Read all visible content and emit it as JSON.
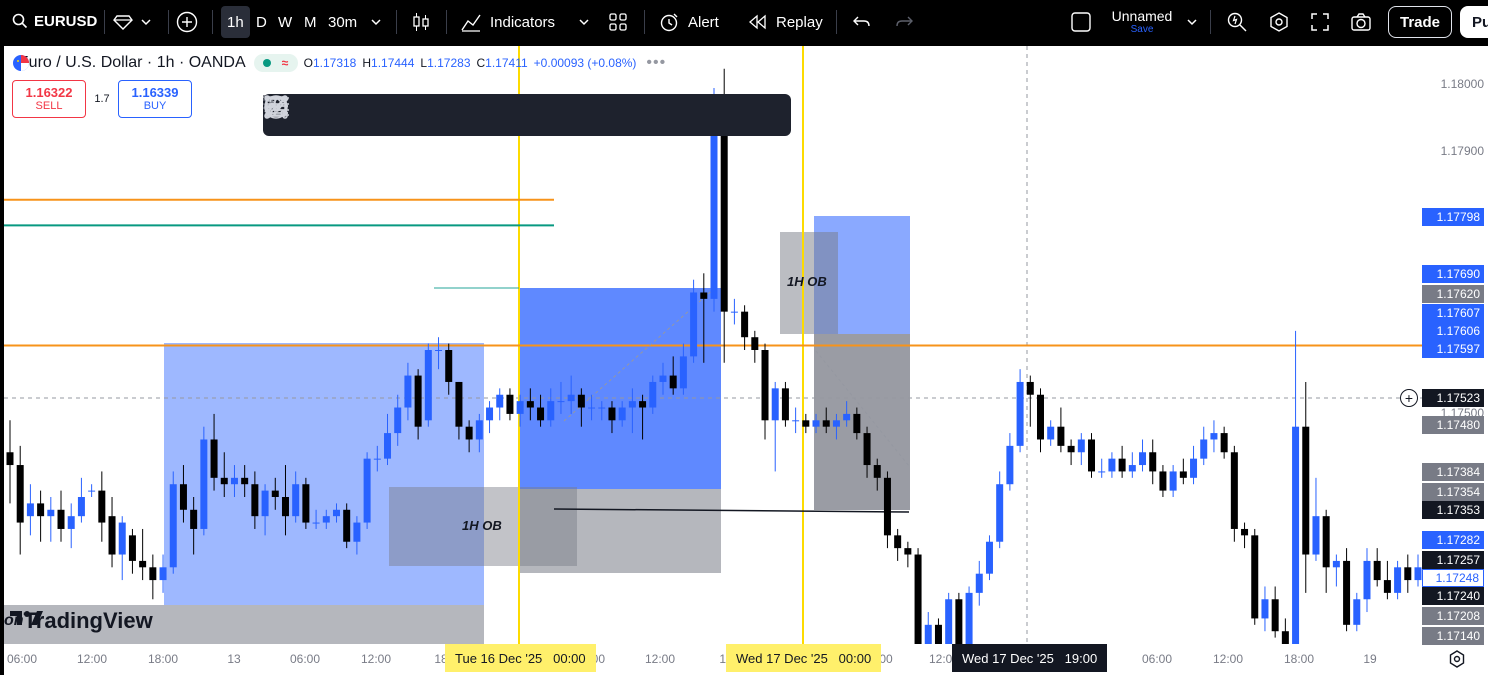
{
  "toolbar": {
    "symbol": "EURUSD",
    "timeframes": [
      "1h",
      "D",
      "W",
      "M",
      "30m"
    ],
    "active_timeframe": "1h",
    "indicators_label": "Indicators",
    "alert_label": "Alert",
    "replay_label": "Replay",
    "layout_name": "Unnamed",
    "layout_save": "Save",
    "trade_label": "Trade",
    "publish_label": "Pu"
  },
  "legend": {
    "title": "Euro / U.S. Dollar · 1h · OANDA",
    "open_key": "O",
    "open": "1.17318",
    "high_key": "H",
    "high": "1.17444",
    "low_key": "L",
    "low": "1.17283",
    "close_key": "C",
    "close": "1.17411",
    "change": "+0.00093 (+0.08%)"
  },
  "order": {
    "sell_price": "1.16322",
    "sell_label": "SELL",
    "spread": "1.7",
    "buy_price": "1.16339",
    "buy_label": "BUY"
  },
  "drawing_tools": [
    "horizontal-lines-icon",
    "circle-target-icon",
    "fib-lines-icon",
    "text-icon",
    "trend-line-icon",
    "path-icon",
    "brush-icon",
    "highlighter-icon",
    "line-icon",
    "rectangle-icon",
    "pitchfork-icon",
    "comment-icon"
  ],
  "annotations": {
    "ob_label_left": "1H OB",
    "ob_label_right": "1H OB",
    "watermark": "TradingView",
    "watermark_partial": "on"
  },
  "price_axis": {
    "ticks": [
      "1.18000",
      "1.17900",
      "1.17500"
    ],
    "labels": [
      {
        "text": "1.17798",
        "color": "#2962ff"
      },
      {
        "text": "1.17690",
        "color": "#2962ff"
      },
      {
        "text": "1.17620",
        "color": "#787b86"
      },
      {
        "text": "1.17607",
        "color": "#2962ff"
      },
      {
        "text": "1.17606",
        "color": "#2962ff"
      },
      {
        "text": "1.17597",
        "color": "#2962ff"
      },
      {
        "text": "1.17523",
        "color": "#131722"
      },
      {
        "text": "1.17480",
        "color": "#787b86"
      },
      {
        "text": "1.17384",
        "color": "#787b86"
      },
      {
        "text": "1.17354",
        "color": "#787b86"
      },
      {
        "text": "1.17353",
        "color": "#131722"
      },
      {
        "text": "1.17282",
        "color": "#2962ff"
      },
      {
        "text": "1.17257",
        "color": "#131722"
      },
      {
        "text": "1.17248",
        "color": "#ffffff"
      },
      {
        "text": "1.17240",
        "color": "#131722"
      },
      {
        "text": "1.17208",
        "color": "#787b86"
      },
      {
        "text": "1.17140",
        "color": "#787b86"
      }
    ]
  },
  "time_axis": {
    "ticks": [
      "06:00",
      "12:00",
      "18:00",
      "13",
      "06:00",
      "12:00",
      "18",
      "06:00",
      "12:00",
      "18",
      "00",
      "12:00",
      "06:00",
      "12:00",
      "18:00",
      "19"
    ],
    "marker_1": "Tue 16 Dec '25   00:00",
    "marker_2": "Wed 17 Dec '25   00:00",
    "crosshair": "Wed 17 Dec '25   19:00"
  },
  "chart_data": {
    "type": "candlestick",
    "symbol": "EURUSD",
    "interval": "1h",
    "ylim": [
      1.1714,
      1.1806
    ],
    "series": [
      {
        "o": 1.1744,
        "c": 1.1742,
        "h": 1.1749,
        "l": 1.1736
      },
      {
        "o": 1.1742,
        "c": 1.1733,
        "h": 1.1745,
        "l": 1.1728
      },
      {
        "o": 1.1734,
        "c": 1.1736,
        "h": 1.1739,
        "l": 1.1731
      },
      {
        "o": 1.1736,
        "c": 1.1734,
        "h": 1.1738,
        "l": 1.173
      },
      {
        "o": 1.1734,
        "c": 1.1735,
        "h": 1.1737,
        "l": 1.173
      },
      {
        "o": 1.1735,
        "c": 1.1732,
        "h": 1.1738,
        "l": 1.173
      },
      {
        "o": 1.1732,
        "c": 1.1734,
        "h": 1.1736,
        "l": 1.1729
      },
      {
        "o": 1.1734,
        "c": 1.1737,
        "h": 1.174,
        "l": 1.1733
      },
      {
        "o": 1.1738,
        "c": 1.1738,
        "h": 1.1739,
        "l": 1.1737
      },
      {
        "o": 1.1738,
        "c": 1.1733,
        "h": 1.1741,
        "l": 1.173
      },
      {
        "o": 1.1734,
        "c": 1.1728,
        "h": 1.1737,
        "l": 1.1726
      },
      {
        "o": 1.1728,
        "c": 1.1733,
        "h": 1.1734,
        "l": 1.1724
      },
      {
        "o": 1.1731,
        "c": 1.1727,
        "h": 1.1732,
        "l": 1.1725
      },
      {
        "o": 1.1727,
        "c": 1.1726,
        "h": 1.1732,
        "l": 1.1724
      },
      {
        "o": 1.1726,
        "c": 1.1724,
        "h": 1.1728,
        "l": 1.1721
      },
      {
        "o": 1.1724,
        "c": 1.1726,
        "h": 1.1728,
        "l": 1.1722
      },
      {
        "o": 1.1726,
        "c": 1.1739,
        "h": 1.1741,
        "l": 1.1725
      },
      {
        "o": 1.1739,
        "c": 1.1735,
        "h": 1.1742,
        "l": 1.1733
      },
      {
        "o": 1.1735,
        "c": 1.1732,
        "h": 1.1737,
        "l": 1.1728
      },
      {
        "o": 1.1732,
        "c": 1.1746,
        "h": 1.1748,
        "l": 1.1731
      },
      {
        "o": 1.1746,
        "c": 1.174,
        "h": 1.175,
        "l": 1.1738
      },
      {
        "o": 1.174,
        "c": 1.1739,
        "h": 1.1744,
        "l": 1.1737
      },
      {
        "o": 1.1739,
        "c": 1.174,
        "h": 1.1742,
        "l": 1.1737
      },
      {
        "o": 1.174,
        "c": 1.1739,
        "h": 1.1742,
        "l": 1.1737
      },
      {
        "o": 1.1739,
        "c": 1.1734,
        "h": 1.1741,
        "l": 1.1732
      },
      {
        "o": 1.1734,
        "c": 1.1738,
        "h": 1.1739,
        "l": 1.1731
      },
      {
        "o": 1.1738,
        "c": 1.1737,
        "h": 1.174,
        "l": 1.1735
      },
      {
        "o": 1.1737,
        "c": 1.1734,
        "h": 1.1742,
        "l": 1.1731
      },
      {
        "o": 1.1734,
        "c": 1.1739,
        "h": 1.1741,
        "l": 1.1733
      },
      {
        "o": 1.1739,
        "c": 1.1733,
        "h": 1.174,
        "l": 1.1732
      },
      {
        "o": 1.1733,
        "c": 1.1733,
        "h": 1.1735,
        "l": 1.1732
      },
      {
        "o": 1.1733,
        "c": 1.1734,
        "h": 1.1735,
        "l": 1.1732
      },
      {
        "o": 1.1734,
        "c": 1.1735,
        "h": 1.1736,
        "l": 1.1733
      },
      {
        "o": 1.1735,
        "c": 1.173,
        "h": 1.1736,
        "l": 1.1729
      },
      {
        "o": 1.173,
        "c": 1.1733,
        "h": 1.1734,
        "l": 1.1728
      },
      {
        "o": 1.1733,
        "c": 1.1743,
        "h": 1.1744,
        "l": 1.1732
      },
      {
        "o": 1.1743,
        "c": 1.1743,
        "h": 1.1745,
        "l": 1.1741
      },
      {
        "o": 1.1743,
        "c": 1.1747,
        "h": 1.175,
        "l": 1.1742
      },
      {
        "o": 1.1747,
        "c": 1.1751,
        "h": 1.1753,
        "l": 1.1745
      },
      {
        "o": 1.1751,
        "c": 1.1756,
        "h": 1.1758,
        "l": 1.1749
      },
      {
        "o": 1.1756,
        "c": 1.1748,
        "h": 1.1757,
        "l": 1.1746
      },
      {
        "o": 1.1749,
        "c": 1.176,
        "h": 1.1761,
        "l": 1.1748
      },
      {
        "o": 1.176,
        "c": 1.176,
        "h": 1.1762,
        "l": 1.1757
      },
      {
        "o": 1.176,
        "c": 1.1755,
        "h": 1.1761,
        "l": 1.1753
      },
      {
        "o": 1.1755,
        "c": 1.1748,
        "h": 1.1755,
        "l": 1.1746
      },
      {
        "o": 1.1748,
        "c": 1.1746,
        "h": 1.1749,
        "l": 1.1744
      },
      {
        "o": 1.1746,
        "c": 1.1749,
        "h": 1.175,
        "l": 1.1744
      },
      {
        "o": 1.1749,
        "c": 1.1751,
        "h": 1.1752,
        "l": 1.1747
      },
      {
        "o": 1.1751,
        "c": 1.1753,
        "h": 1.1754,
        "l": 1.1749
      },
      {
        "o": 1.1753,
        "c": 1.175,
        "h": 1.1754,
        "l": 1.1749
      },
      {
        "o": 1.175,
        "c": 1.1752,
        "h": 1.1753,
        "l": 1.1748
      },
      {
        "o": 1.1752,
        "c": 1.1751,
        "h": 1.1754,
        "l": 1.1749
      },
      {
        "o": 1.1751,
        "c": 1.1749,
        "h": 1.1753,
        "l": 1.1748
      },
      {
        "o": 1.1749,
        "c": 1.1752,
        "h": 1.1754,
        "l": 1.1748
      },
      {
        "o": 1.1752,
        "c": 1.1752,
        "h": 1.1755,
        "l": 1.175
      },
      {
        "o": 1.1752,
        "c": 1.1753,
        "h": 1.1756,
        "l": 1.175
      },
      {
        "o": 1.1753,
        "c": 1.1751,
        "h": 1.1754,
        "l": 1.1748
      },
      {
        "o": 1.1751,
        "c": 1.1751,
        "h": 1.1753,
        "l": 1.1749
      },
      {
        "o": 1.1751,
        "c": 1.1751,
        "h": 1.1752,
        "l": 1.1749
      },
      {
        "o": 1.1751,
        "c": 1.1749,
        "h": 1.1752,
        "l": 1.1747
      },
      {
        "o": 1.1749,
        "c": 1.1751,
        "h": 1.1752,
        "l": 1.1748
      },
      {
        "o": 1.1751,
        "c": 1.1752,
        "h": 1.1754,
        "l": 1.1747
      },
      {
        "o": 1.1752,
        "c": 1.1751,
        "h": 1.1753,
        "l": 1.1746
      },
      {
        "o": 1.1751,
        "c": 1.1755,
        "h": 1.1756,
        "l": 1.175
      },
      {
        "o": 1.1755,
        "c": 1.1756,
        "h": 1.1758,
        "l": 1.1753
      },
      {
        "o": 1.1756,
        "c": 1.1754,
        "h": 1.1759,
        "l": 1.1753
      },
      {
        "o": 1.1754,
        "c": 1.1759,
        "h": 1.1761,
        "l": 1.1753
      },
      {
        "o": 1.1759,
        "c": 1.1769,
        "h": 1.1771,
        "l": 1.1758
      },
      {
        "o": 1.1769,
        "c": 1.1768,
        "h": 1.1772,
        "l": 1.1758
      },
      {
        "o": 1.1768,
        "c": 1.18,
        "h": 1.1801,
        "l": 1.1766
      },
      {
        "o": 1.18,
        "c": 1.1766,
        "h": 1.1804,
        "l": 1.1758
      },
      {
        "o": 1.1766,
        "c": 1.1766,
        "h": 1.1768,
        "l": 1.1764
      },
      {
        "o": 1.1766,
        "c": 1.1762,
        "h": 1.1767,
        "l": 1.176
      },
      {
        "o": 1.1762,
        "c": 1.176,
        "h": 1.1763,
        "l": 1.1758
      },
      {
        "o": 1.176,
        "c": 1.1749,
        "h": 1.1761,
        "l": 1.1746
      },
      {
        "o": 1.1749,
        "c": 1.1754,
        "h": 1.1755,
        "l": 1.1741
      },
      {
        "o": 1.1754,
        "c": 1.1749,
        "h": 1.1755,
        "l": 1.1748
      },
      {
        "o": 1.1749,
        "c": 1.1749,
        "h": 1.1751,
        "l": 1.1747
      },
      {
        "o": 1.1749,
        "c": 1.1748,
        "h": 1.175,
        "l": 1.1747
      },
      {
        "o": 1.1748,
        "c": 1.1749,
        "h": 1.175,
        "l": 1.1747
      },
      {
        "o": 1.1749,
        "c": 1.1748,
        "h": 1.1751,
        "l": 1.1747
      },
      {
        "o": 1.1748,
        "c": 1.1749,
        "h": 1.175,
        "l": 1.1746
      },
      {
        "o": 1.1749,
        "c": 1.175,
        "h": 1.1752,
        "l": 1.1748
      },
      {
        "o": 1.175,
        "c": 1.1747,
        "h": 1.1751,
        "l": 1.1746
      },
      {
        "o": 1.1747,
        "c": 1.1742,
        "h": 1.1748,
        "l": 1.174
      },
      {
        "o": 1.1742,
        "c": 1.174,
        "h": 1.1743,
        "l": 1.1738
      },
      {
        "o": 1.174,
        "c": 1.1731,
        "h": 1.1741,
        "l": 1.1729
      },
      {
        "o": 1.1731,
        "c": 1.1729,
        "h": 1.1732,
        "l": 1.1727
      },
      {
        "o": 1.1729,
        "c": 1.1728,
        "h": 1.173,
        "l": 1.1726
      },
      {
        "o": 1.1728,
        "c": 1.1714,
        "h": 1.1729,
        "l": 1.1714
      },
      {
        "o": 1.1714,
        "c": 1.1717,
        "h": 1.1719,
        "l": 1.1714
      },
      {
        "o": 1.1717,
        "c": 1.1714,
        "h": 1.1718,
        "l": 1.1714
      },
      {
        "o": 1.1714,
        "c": 1.1721,
        "h": 1.1722,
        "l": 1.1714
      },
      {
        "o": 1.1721,
        "c": 1.1714,
        "h": 1.1722,
        "l": 1.1714
      },
      {
        "o": 1.1714,
        "c": 1.1722,
        "h": 1.1723,
        "l": 1.1714
      },
      {
        "o": 1.1722,
        "c": 1.1725,
        "h": 1.1727,
        "l": 1.172
      },
      {
        "o": 1.1725,
        "c": 1.173,
        "h": 1.1731,
        "l": 1.1724
      },
      {
        "o": 1.173,
        "c": 1.1739,
        "h": 1.1741,
        "l": 1.1729
      },
      {
        "o": 1.1739,
        "c": 1.1745,
        "h": 1.1747,
        "l": 1.1738
      },
      {
        "o": 1.1745,
        "c": 1.1755,
        "h": 1.1757,
        "l": 1.1744
      },
      {
        "o": 1.1755,
        "c": 1.1753,
        "h": 1.1756,
        "l": 1.1748
      },
      {
        "o": 1.1753,
        "c": 1.1746,
        "h": 1.1754,
        "l": 1.1744
      },
      {
        "o": 1.1746,
        "c": 1.1748,
        "h": 1.1749,
        "l": 1.1745
      },
      {
        "o": 1.1748,
        "c": 1.1745,
        "h": 1.1751,
        "l": 1.1744
      },
      {
        "o": 1.1745,
        "c": 1.1744,
        "h": 1.1746,
        "l": 1.1742
      },
      {
        "o": 1.1744,
        "c": 1.1746,
        "h": 1.1747,
        "l": 1.1742
      },
      {
        "o": 1.1746,
        "c": 1.1741,
        "h": 1.1747,
        "l": 1.174
      },
      {
        "o": 1.1741,
        "c": 1.1741,
        "h": 1.1743,
        "l": 1.174
      },
      {
        "o": 1.1741,
        "c": 1.1743,
        "h": 1.1744,
        "l": 1.174
      },
      {
        "o": 1.1743,
        "c": 1.1741,
        "h": 1.1745,
        "l": 1.174
      },
      {
        "o": 1.1741,
        "c": 1.1742,
        "h": 1.1744,
        "l": 1.174
      },
      {
        "o": 1.1742,
        "c": 1.1744,
        "h": 1.1746,
        "l": 1.1741
      },
      {
        "o": 1.1744,
        "c": 1.1741,
        "h": 1.1746,
        "l": 1.1739
      },
      {
        "o": 1.1741,
        "c": 1.1738,
        "h": 1.1742,
        "l": 1.1737
      },
      {
        "o": 1.1738,
        "c": 1.1741,
        "h": 1.1742,
        "l": 1.1737
      },
      {
        "o": 1.1741,
        "c": 1.174,
        "h": 1.1743,
        "l": 1.1739
      },
      {
        "o": 1.174,
        "c": 1.1743,
        "h": 1.1745,
        "l": 1.1739
      },
      {
        "o": 1.1743,
        "c": 1.1746,
        "h": 1.1748,
        "l": 1.1742
      },
      {
        "o": 1.1746,
        "c": 1.1747,
        "h": 1.1749,
        "l": 1.1744
      },
      {
        "o": 1.1747,
        "c": 1.1744,
        "h": 1.1748,
        "l": 1.1743
      },
      {
        "o": 1.1744,
        "c": 1.1732,
        "h": 1.1745,
        "l": 1.173
      },
      {
        "o": 1.1732,
        "c": 1.1731,
        "h": 1.1733,
        "l": 1.1729
      },
      {
        "o": 1.1731,
        "c": 1.1718,
        "h": 1.1732,
        "l": 1.1717
      },
      {
        "o": 1.1718,
        "c": 1.1721,
        "h": 1.1723,
        "l": 1.1716
      },
      {
        "o": 1.1721,
        "c": 1.1716,
        "h": 1.1723,
        "l": 1.1715
      },
      {
        "o": 1.1716,
        "c": 1.1714,
        "h": 1.1718,
        "l": 1.1714
      },
      {
        "o": 1.1714,
        "c": 1.1748,
        "h": 1.1763,
        "l": 1.1714
      },
      {
        "o": 1.1748,
        "c": 1.1728,
        "h": 1.1755,
        "l": 1.1722
      },
      {
        "o": 1.1728,
        "c": 1.1734,
        "h": 1.174,
        "l": 1.1727
      },
      {
        "o": 1.1734,
        "c": 1.1726,
        "h": 1.1735,
        "l": 1.1722
      },
      {
        "o": 1.1726,
        "c": 1.1727,
        "h": 1.1728,
        "l": 1.1723
      },
      {
        "o": 1.1727,
        "c": 1.1717,
        "h": 1.1729,
        "l": 1.1716
      },
      {
        "o": 1.1717,
        "c": 1.1721,
        "h": 1.1722,
        "l": 1.1716
      },
      {
        "o": 1.1721,
        "c": 1.1727,
        "h": 1.1729,
        "l": 1.1719
      },
      {
        "o": 1.1727,
        "c": 1.1724,
        "h": 1.1729,
        "l": 1.1723
      },
      {
        "o": 1.1724,
        "c": 1.1722,
        "h": 1.1727,
        "l": 1.1721
      },
      {
        "o": 1.1722,
        "c": 1.1726,
        "h": 1.1727,
        "l": 1.1721
      },
      {
        "o": 1.1726,
        "c": 1.1724,
        "h": 1.1728,
        "l": 1.1722
      },
      {
        "o": 1.1724,
        "c": 1.1726,
        "h": 1.1728,
        "l": 1.1723
      }
    ],
    "horizontal_lines": [
      {
        "price": 1.17835,
        "color": "#f7931a"
      },
      {
        "price": 1.17795,
        "color": "#089981"
      },
      {
        "price": 1.17607,
        "color": "#f7931a"
      }
    ],
    "zones": [
      {
        "type": "demand-blue"
      },
      {
        "type": "demand-blue"
      },
      {
        "type": "supply-blue"
      },
      {
        "type": "order-block-grey"
      },
      {
        "type": "order-block-grey"
      },
      {
        "type": "order-block-grey"
      }
    ]
  }
}
